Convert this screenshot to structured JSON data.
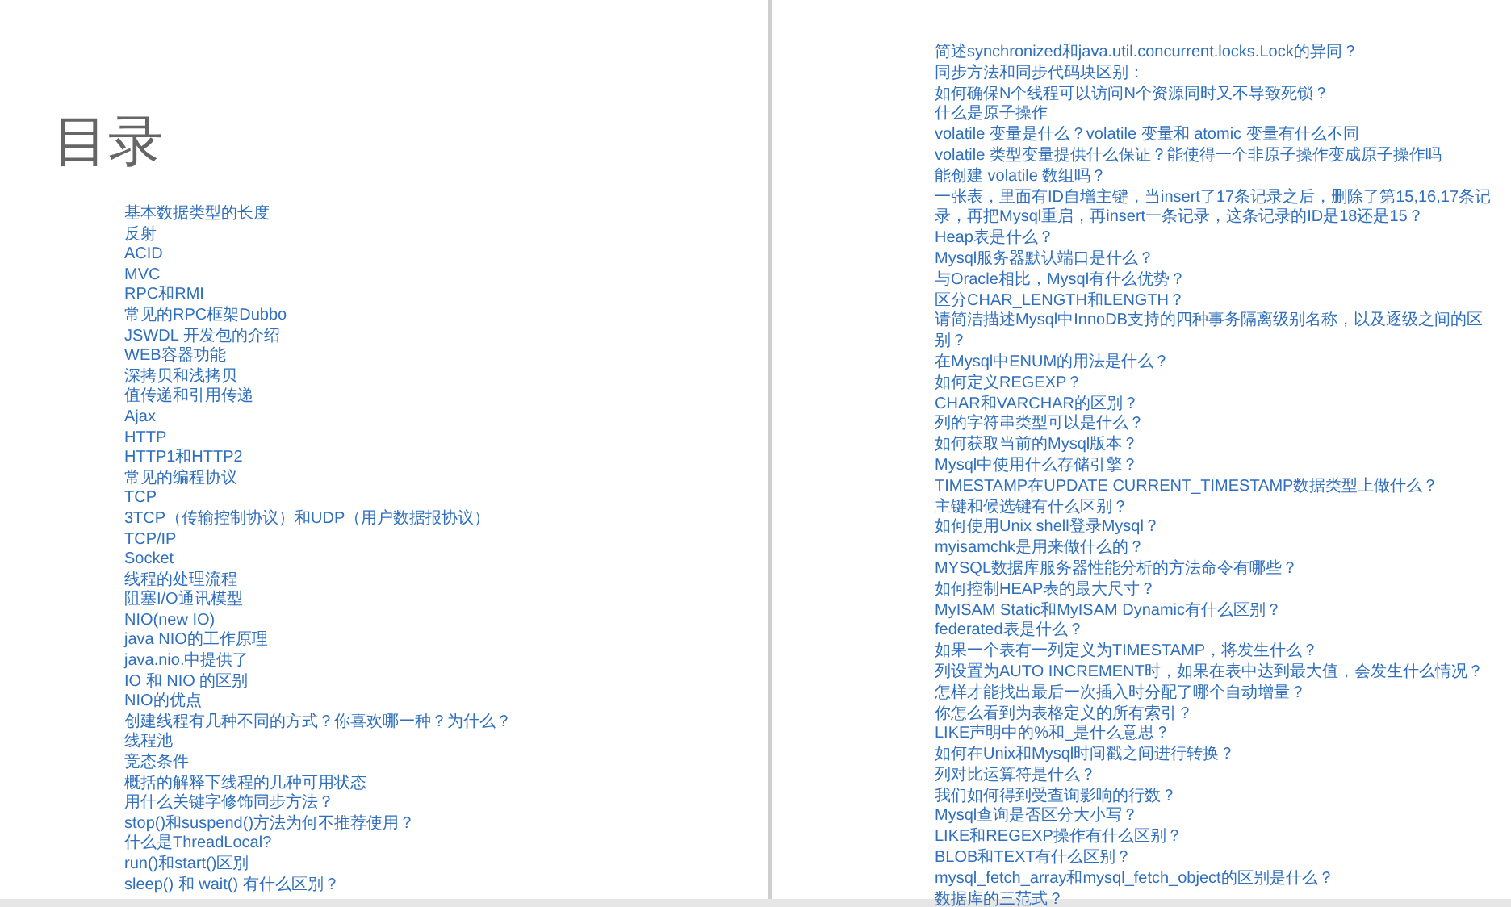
{
  "left_page": {
    "title": "目录",
    "entries": [
      "基本数据类型的长度",
      "反射",
      "ACID",
      "MVC",
      "RPC和RMI",
      "常见的RPC框架Dubbo",
      "JSWDL 开发包的介绍",
      "WEB容器功能",
      "深拷贝和浅拷贝",
      "值传递和引用传递",
      "Ajax",
      "HTTP",
      "HTTP1和HTTP2",
      "常见的编程协议",
      "TCP",
      "3TCP（传输控制协议）和UDP（用户数据报协议）",
      "TCP/IP",
      "Socket",
      "线程的处理流程",
      "阻塞I/O通讯模型",
      "NIO(new IO)",
      "java NIO的工作原理",
      "java.nio.中提供了",
      "IO 和 NIO 的区别",
      "NIO的优点",
      "创建线程有几种不同的方式？你喜欢哪一种？为什么？",
      "线程池",
      "竞态条件",
      "概括的解释下线程的几种可用状态",
      "用什么关键字修饰同步方法？",
      "stop()和suspend()方法为何不推荐使用？",
      "什么是ThreadLocal?",
      "run()和start()区别",
      "sleep() 和 wait() 有什么区别？"
    ]
  },
  "right_page": {
    "entries": [
      "简述synchronized和java.util.concurrent.locks.Lock的异同？",
      "同步方法和同步代码块区别：",
      "如何确保N个线程可以访问N个资源同时又不导致死锁？",
      "什么是原子操作",
      "volatile 变量是什么？volatile 变量和 atomic 变量有什么不同",
      "volatile 类型变量提供什么保证？能使得一个非原子操作变成原子操作吗",
      "能创建 volatile 数组吗？",
      "一张表，里面有ID自增主键，当insert了17条记录之后，删除了第15,16,17条记录，再把Mysql重启，再insert一条记录，这条记录的ID是18还是15？",
      "Heap表是什么？",
      "Mysql服务器默认端口是什么？",
      "与Oracle相比，Mysql有什么优势？",
      "区分CHAR_LENGTH和LENGTH？",
      "请简洁描述Mysql中InnoDB支持的四种事务隔离级别名称，以及逐级之间的区别？",
      "在Mysql中ENUM的用法是什么？",
      "如何定义REGEXP？",
      "CHAR和VARCHAR的区别？",
      "列的字符串类型可以是什么？",
      "如何获取当前的Mysql版本？",
      "Mysql中使用什么存储引擎？",
      "TIMESTAMP在UPDATE CURRENT_TIMESTAMP数据类型上做什么？",
      "主键和候选键有什么区别？",
      "如何使用Unix shell登录Mysql？",
      "myisamchk是用来做什么的？",
      "MYSQL数据库服务器性能分析的方法命令有哪些？",
      "如何控制HEAP表的最大尺寸？",
      "MyISAM Static和MyISAM Dynamic有什么区别？",
      "federated表是什么？",
      "如果一个表有一列定义为TIMESTAMP，将发生什么？",
      "列设置为AUTO INCREMENT时，如果在表中达到最大值，会发生什么情况？",
      "怎样才能找出最后一次插入时分配了哪个自动增量？",
      "你怎么看到为表格定义的所有索引？",
      "LIKE声明中的%和_是什么意思？",
      "如何在Unix和Mysql时间戳之间进行转换？",
      "列对比运算符是什么？",
      "我们如何得到受查询影响的行数？",
      "Mysql查询是否区分大小写？",
      "LIKE和REGEXP操作有什么区别？",
      "BLOB和TEXT有什么区别？",
      "mysql_fetch_array和mysql_fetch_object的区别是什么？",
      "数据库的三范式？"
    ]
  }
}
